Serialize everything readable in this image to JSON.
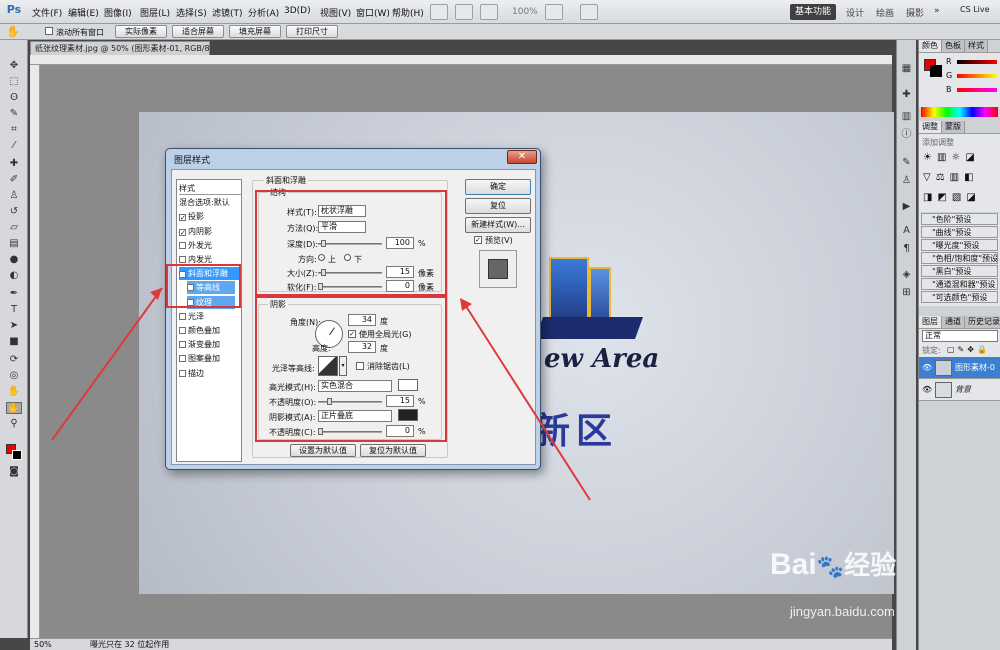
{
  "app": {
    "logo": "Ps"
  },
  "menu": [
    "文件(F)",
    "编辑(E)",
    "图像(I)",
    "图层(L)",
    "选择(S)",
    "滤镜(T)",
    "分析(A)",
    "3D(D)",
    "视图(V)",
    "窗口(W)",
    "帮助(H)"
  ],
  "zoom_display": "100%",
  "workspace": {
    "active": "基本功能",
    "others": [
      "设计",
      "绘画",
      "摄影"
    ],
    "cs_live": "CS Live"
  },
  "options_bar": {
    "scroll_all": "滚动所有窗口",
    "buttons": [
      "实际像素",
      "适合屏幕",
      "填充屏幕",
      "打印尺寸"
    ]
  },
  "document_tab": "纸张纹理素材.jpg @ 50% (图形素材-01, RGB/8) *",
  "artwork": {
    "tagline": "ew Area",
    "chinese": "新区"
  },
  "status": {
    "zoom": "50%",
    "message": "曝光只在 32 位起作用"
  },
  "panels": {
    "color_tabs": [
      "颜色",
      "色板",
      "样式"
    ],
    "color_values": [
      "R",
      "G",
      "B"
    ],
    "adjust_tabs": [
      "调整",
      "蒙版"
    ],
    "adjust_title": "添加调整",
    "presets": [
      "\"色阶\"预设",
      "\"曲线\"预设",
      "\"曝光度\"预设",
      "\"色相/饱和度\"预设",
      "\"黑白\"预设",
      "\"通道混和器\"预设",
      "\"可选颜色\"预设"
    ],
    "layer_tabs": [
      "图层",
      "通道",
      "历史记录"
    ],
    "blend_mode": "正常",
    "lock_label": "锁定:",
    "layers": [
      {
        "name": "图形素材-0"
      },
      {
        "name": "背景"
      }
    ]
  },
  "dialog": {
    "title": "图层样式",
    "close": "✕",
    "style_list": [
      {
        "label": "样式",
        "checkbox": false
      },
      {
        "label": "混合选项:默认",
        "checkbox": false
      },
      {
        "label": "投影",
        "checkbox": true,
        "checked": true
      },
      {
        "label": "内阴影",
        "checkbox": true,
        "checked": true
      },
      {
        "label": "外发光",
        "checkbox": true,
        "checked": false
      },
      {
        "label": "内发光",
        "checkbox": true,
        "checked": false
      },
      {
        "label": "斜面和浮雕",
        "checkbox": true,
        "checked": true,
        "selected": true
      },
      {
        "label": "等高线",
        "checkbox": true,
        "checked": false,
        "sub": true
      },
      {
        "label": "纹理",
        "checkbox": true,
        "checked": false,
        "sub": true
      },
      {
        "label": "光泽",
        "checkbox": true,
        "checked": false
      },
      {
        "label": "颜色叠加",
        "checkbox": true,
        "checked": false
      },
      {
        "label": "渐变叠加",
        "checkbox": true,
        "checked": false
      },
      {
        "label": "图案叠加",
        "checkbox": true,
        "checked": false
      },
      {
        "label": "描边",
        "checkbox": true,
        "checked": false
      }
    ],
    "section_title": "斜面和浮雕",
    "structure": {
      "title": "结构",
      "style_label": "样式(T):",
      "style_value": "枕状浮雕",
      "method_label": "方法(Q):",
      "method_value": "平滑",
      "depth_label": "深度(D):",
      "depth_value": "100",
      "depth_unit": "%",
      "direction_label": "方向:",
      "dir_up": "上",
      "dir_down": "下",
      "size_label": "大小(Z):",
      "size_value": "15",
      "size_unit": "像素",
      "soften_label": "软化(F):",
      "soften_value": "0",
      "soften_unit": "像素"
    },
    "shading": {
      "title": "阴影",
      "angle_label": "角度(N):",
      "angle_value": "34",
      "angle_unit": "度",
      "global_light": "使用全局光(G)",
      "altitude_label": "高度:",
      "altitude_value": "32",
      "altitude_unit": "度",
      "gloss_label": "光泽等高线:",
      "antialias": "消除锯齿(L)",
      "highlight_label": "高光模式(H):",
      "highlight_mode": "实色混合",
      "highlight_color": "#ffffff",
      "highlight_opacity_label": "不透明度(O):",
      "highlight_opacity": "15",
      "pct": "%",
      "shadow_label": "阴影模式(A):",
      "shadow_mode": "正片叠底",
      "shadow_color": "#222222",
      "shadow_opacity_label": "不透明度(C):",
      "shadow_opacity": "0"
    },
    "buttons": {
      "ok": "确定",
      "reset": "复位",
      "new_style": "新建样式(W)...",
      "preview": "预览(V)"
    },
    "default_buttons": [
      "设置为默认值",
      "复位为默认值"
    ]
  },
  "watermark": {
    "brand": "Bai",
    "brand2": "经验",
    "url": "jingyan.baidu.com"
  }
}
